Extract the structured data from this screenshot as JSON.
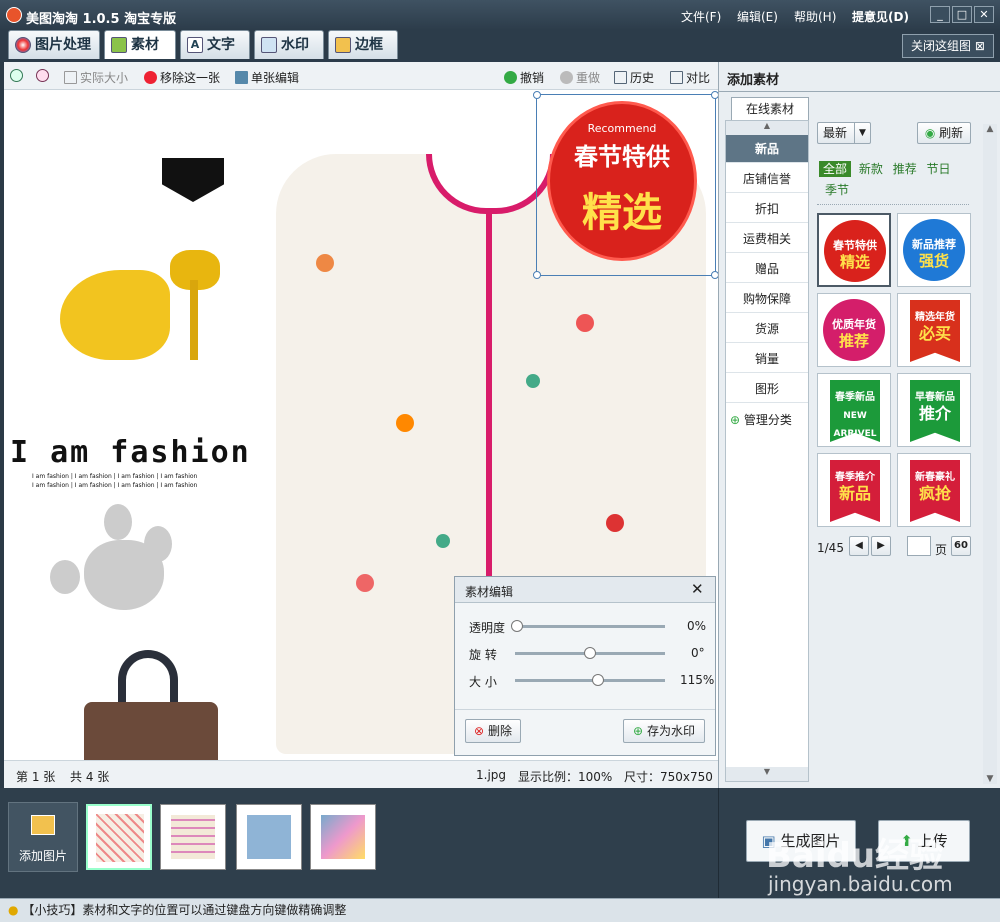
{
  "app": {
    "title": "美图淘淘 1.0.5 淘宝专版"
  },
  "menu": [
    "文件(F)",
    "编辑(E)",
    "帮助(H)",
    "提意见(D)"
  ],
  "window_buttons": [
    "_",
    "□",
    "✕"
  ],
  "tabs": [
    "图片处理",
    "素材",
    "文字",
    "水印",
    "边框"
  ],
  "close_group": "关闭这组图",
  "toolbar": {
    "zoom_in": "",
    "zoom_out": "",
    "actual_size": "实际大小",
    "remove": "移除这一张",
    "single_edit": "单张编辑",
    "undo": "撤销",
    "redo": "重做",
    "history": "历史",
    "compare": "对比"
  },
  "canvas": {
    "fashion_title": "I am fashion",
    "fashion_sub": "I am fashion | I am fashion | I am fashion | I am fashion",
    "fashion_sub2": "I am fashion | I am fashion | I am fashion | I am fashion",
    "sticker_en": "Recommend",
    "sticker_line1": "春节特供",
    "sticker_line2": "精选"
  },
  "status": {
    "page": "第 1 张",
    "total": "共 4 张",
    "file": "1.jpg",
    "ratio": "显示比例：100%",
    "size": "尺寸：750x750"
  },
  "panel": {
    "title": "添加素材",
    "online_tab": "在线素材",
    "categories": [
      "新品",
      "店铺信誉",
      "折扣",
      "运费相关",
      "赠品",
      "购物保障",
      "货源",
      "销量",
      "图形"
    ],
    "manage": "管理分类",
    "sort": "最新",
    "refresh": "刷新",
    "filters": [
      "全部",
      "新款",
      "推荐",
      "节日",
      "季节"
    ],
    "pager": "1/45",
    "page_label": "页",
    "go": "60",
    "thumbs": [
      {
        "type": "badge",
        "line1": "春节特供",
        "line2": "精选",
        "color": "#d9221c"
      },
      {
        "type": "badge",
        "line1": "新品推荐",
        "line2": "强货",
        "color": "#1f79d6"
      },
      {
        "type": "badge",
        "line1": "优质年货",
        "line2": "推荐",
        "color": "#d41e6a"
      },
      {
        "type": "flag",
        "line1": "精选年货",
        "line2": "必买",
        "color": "#d8301c"
      },
      {
        "type": "flag",
        "line1": "春季新品",
        "line2": "NEW ARRIVEL",
        "color": "#1c9a3a"
      },
      {
        "type": "flag",
        "line1": "早春新品",
        "line2": "推介",
        "color": "#1c9a3a"
      },
      {
        "type": "flag",
        "line1": "春季推介",
        "line2": "新品",
        "color": "#d41e3a"
      },
      {
        "type": "flag",
        "line1": "新春豪礼",
        "line2": "疯抢",
        "color": "#d41e3a"
      }
    ]
  },
  "dialog": {
    "title": "素材编辑",
    "rows": [
      {
        "label": "透明度",
        "value": "0%",
        "pos": 0
      },
      {
        "label": "旋  转",
        "value": "0°",
        "pos": 0.5
      },
      {
        "label": "大  小",
        "value": "115%",
        "pos": 0.55
      }
    ],
    "delete": "删除",
    "save_watermark": "存为水印"
  },
  "bottom": {
    "add_image": "添加图片",
    "generate": "生成图片",
    "upload": "上传"
  },
  "hint": "【小技巧】素材和文字的位置可以通过键盘方向键做精确调整",
  "watermark": "Baidu经验",
  "watermark2": "jingyan.baidu.com"
}
